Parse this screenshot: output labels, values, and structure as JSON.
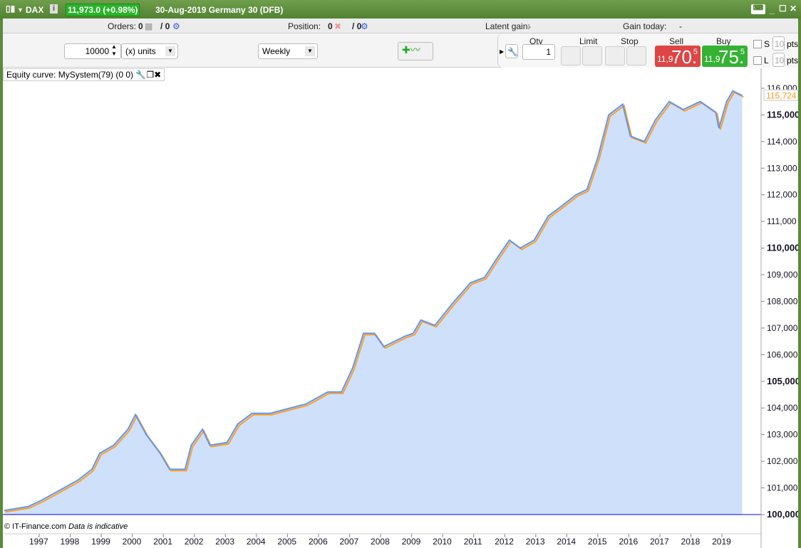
{
  "titlebar": {
    "symbol": "DAX",
    "quote": "11,973.0 (+0.98%)",
    "description": "30-Aug-2019 Germany 30 (DFB)"
  },
  "status": {
    "orders_label": "Orders:",
    "orders_value": "0",
    "orders_total": "/ 0",
    "position_label": "Position:",
    "position_value": "0",
    "position_total": "/ 0",
    "latent_label": "Latent gain:",
    "latent_value": "-",
    "gain_today_label": "Gain today:",
    "gain_today_value": "-"
  },
  "toolbar": {
    "capital": "10000",
    "units": "(x) units",
    "timeframe": "Weekly",
    "qty_label": "Qty",
    "qty": "1",
    "limit_label": "Limit",
    "stop_label": "Stop",
    "sell_label": "Sell",
    "buy_label": "Buy",
    "sell_small": "11,9",
    "sell_big": "70.",
    "sell_exp": "5",
    "buy_small": "11,9",
    "buy_big": "75.",
    "buy_exp": "5",
    "s_label": "S",
    "l_label": "L",
    "s_pts": "10",
    "l_pts": "10",
    "pts": "pts"
  },
  "chart_panel_title": "Equity curve: MySystem(79) (0 0)",
  "copyright": "© IT-Finance.com",
  "disclaimer": "Data is indicative",
  "colors": {
    "equity_line": "#6495ed",
    "equity_fill": "#cfe0fb",
    "underlying": "#ffa020",
    "baseline": "#0000dd",
    "title_green": "#5a8a3a"
  },
  "chart_data": {
    "type": "area",
    "title": "Equity curve: MySystem(79) (0 0)",
    "current_value_label": "115,724",
    "ylim": [
      100000,
      116000
    ],
    "y_ticks": [
      "100,000",
      "101,000",
      "102,000",
      "103,000",
      "104,000",
      "105,000",
      "106,000",
      "107,000",
      "108,000",
      "109,000",
      "110,000",
      "111,000",
      "112,000",
      "113,000",
      "114,000",
      "115,000",
      "116,000"
    ],
    "x_ticks": [
      "1997",
      "1998",
      "1999",
      "2000",
      "2001",
      "2002",
      "2003",
      "2004",
      "2005",
      "2006",
      "2007",
      "2008",
      "2009",
      "2010",
      "2011",
      "2012",
      "2013",
      "2014",
      "2015",
      "2016",
      "2017",
      "2018",
      "2019"
    ],
    "baseline": 100000,
    "series": [
      {
        "x": [
          1995.87,
          1996.65,
          1997.1,
          1997.8,
          1998.26,
          1998.7,
          1998.95,
          1999.4,
          1999.86,
          2000.1,
          2000.45,
          2000.9,
          2001.2,
          2001.7,
          2001.9,
          2002.26,
          2002.5,
          2003.05,
          2003.4,
          2003.86,
          2004.45,
          2005.1,
          2005.6,
          2006.3,
          2006.74,
          2007.1,
          2007.45,
          2007.8,
          2008.1,
          2008.8,
          2009.05,
          2009.3,
          2009.75,
          2010.3,
          2010.9,
          2011.35,
          2011.8,
          2012.15,
          2012.5,
          2012.95,
          2013.4,
          2013.86,
          2014.3,
          2014.65,
          2015.0,
          2015.35,
          2015.8,
          2016.05,
          2016.5,
          2016.85,
          2017.3,
          2017.75,
          2018.3,
          2018.8,
          2018.9,
          2019.15,
          2019.35,
          2019.65
        ],
        "y": [
          100150,
          100300,
          100550,
          101000,
          101300,
          101700,
          102300,
          102600,
          103200,
          103750,
          103000,
          102300,
          101700,
          101700,
          102600,
          103200,
          102600,
          102700,
          103400,
          103800,
          103800,
          104000,
          104150,
          104600,
          104600,
          105500,
          106800,
          106800,
          106300,
          106700,
          106800,
          107300,
          107100,
          107900,
          108700,
          108900,
          109700,
          110300,
          110000,
          110300,
          111200,
          111600,
          112000,
          112200,
          113400,
          115000,
          115400,
          114200,
          114000,
          114800,
          115500,
          115200,
          115500,
          115100,
          114500,
          115500,
          115900,
          115724
        ]
      }
    ]
  }
}
